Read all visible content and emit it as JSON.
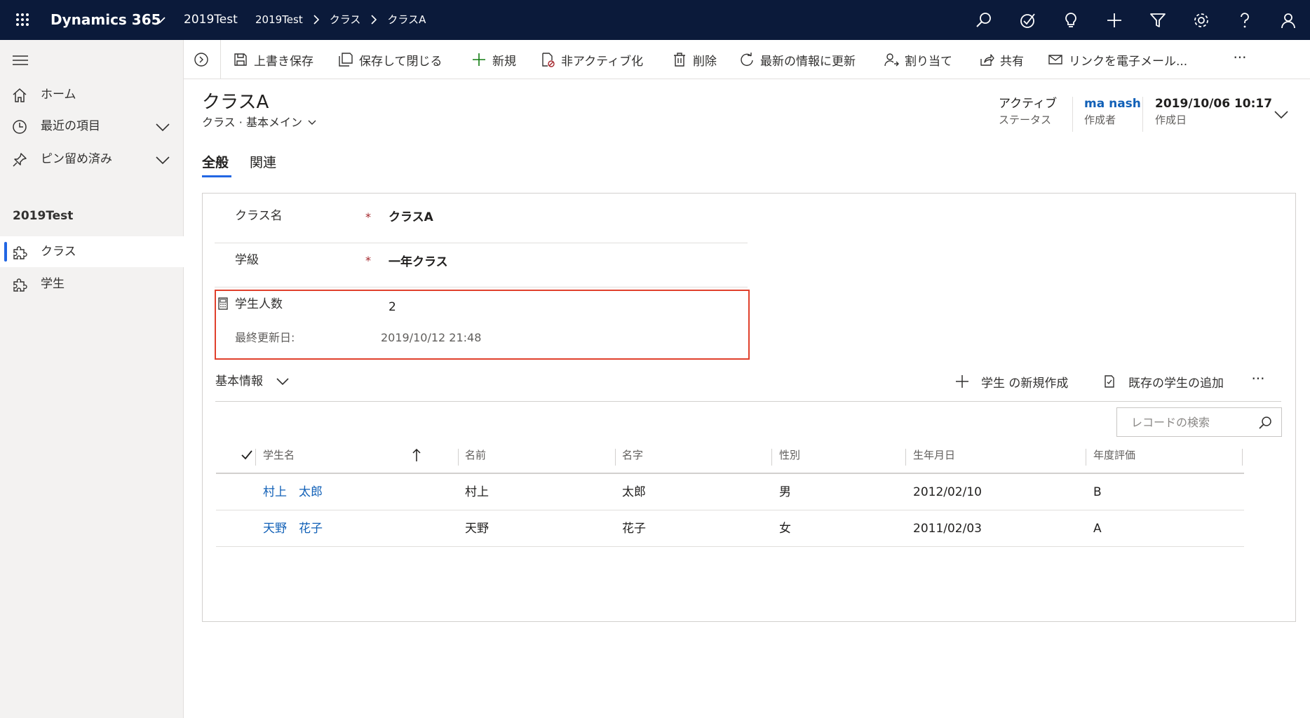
{
  "topbar": {
    "app_name": "Dynamics 365",
    "environment": "2019Test",
    "breadcrumb": [
      "2019Test",
      "クラス",
      "クラスA"
    ],
    "icons": [
      "search-icon",
      "task-icon",
      "lightbulb-icon",
      "plus-icon",
      "filter-icon",
      "settings-icon",
      "help-icon",
      "user-icon"
    ]
  },
  "nav": {
    "home": "ホーム",
    "recent": "最近の項目",
    "pinned": "ピン留め済み",
    "group": "2019Test",
    "entities": [
      "クラス",
      "学生"
    ]
  },
  "commands": {
    "save": "上書き保存",
    "save_close": "保存して閉じる",
    "new": "新規",
    "deactivate": "非アクティブ化",
    "delete": "削除",
    "refresh": "最新の情報に更新",
    "assign": "割り当て",
    "share": "共有",
    "email_link": "リンクを電子メール...",
    "more": "···"
  },
  "header": {
    "title": "クラスA",
    "entity": "クラス",
    "form": "基本メイン",
    "status_value": "アクティブ",
    "status_label": "ステータス",
    "owner_value": "ma nash",
    "owner_label": "作成者",
    "created_value": "2019/10/06 10:17",
    "created_label": "作成日"
  },
  "tabs": [
    "全般",
    "関連"
  ],
  "form": {
    "class_name_label": "クラス名",
    "class_name_value": "クラスA",
    "grade_label": "学級",
    "grade_value": "一年クラス",
    "required_mark": "*",
    "student_count_label": "学生人数",
    "student_count_value": "2",
    "last_updated_label": "最終更新日:",
    "last_updated_value": "2019/10/12 21:48"
  },
  "subgrid": {
    "title": "基本情報",
    "new_student": "学生 の新規作成",
    "add_existing": "既存の学生の追加",
    "more": "···",
    "search_placeholder": "レコードの検索",
    "columns": [
      "学生名",
      "名前",
      "名字",
      "性別",
      "生年月日",
      "年度評価"
    ],
    "rows": [
      [
        "村上　太郎",
        "村上",
        "太郎",
        "男",
        "2012/02/10",
        "B"
      ],
      [
        "天野　花子",
        "天野",
        "花子",
        "女",
        "2011/02/03",
        "A"
      ]
    ]
  },
  "colors": {
    "topbar_bg": "#0b1a3a",
    "accent": "#2266e3",
    "link": "#1160b7",
    "highlight_border": "#e0402c",
    "required": "#a4262c"
  }
}
